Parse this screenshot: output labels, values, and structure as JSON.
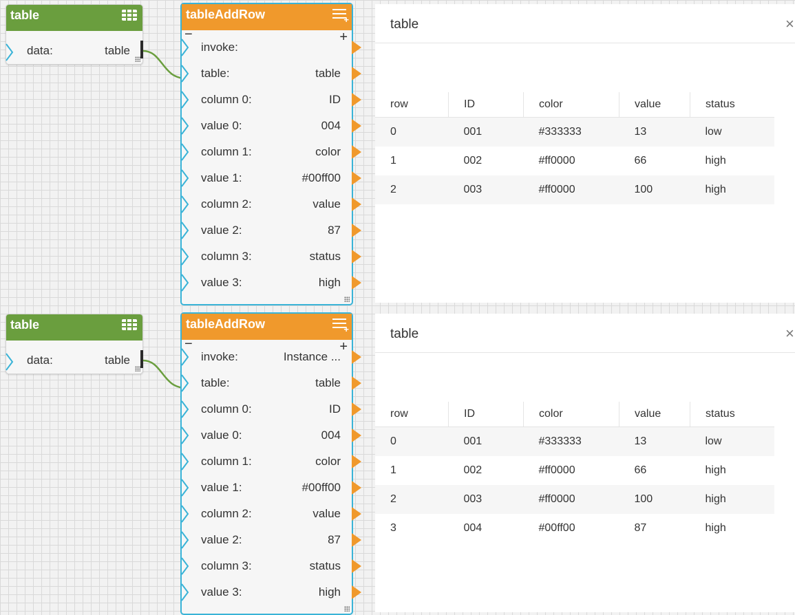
{
  "flows": [
    {
      "table_node": {
        "title": "table",
        "port_label": "data:",
        "port_value": "table"
      },
      "action_node": {
        "title": "tableAddRow",
        "rows": [
          {
            "label": "invoke:",
            "value": ""
          },
          {
            "label": "table:",
            "value": "table"
          },
          {
            "label": "column 0:",
            "value": "ID"
          },
          {
            "label": "value 0:",
            "value": "004"
          },
          {
            "label": "column 1:",
            "value": "color"
          },
          {
            "label": "value 1:",
            "value": "#00ff00"
          },
          {
            "label": "column 2:",
            "value": "value"
          },
          {
            "label": "value 2:",
            "value": "87"
          },
          {
            "label": "column 3:",
            "value": "status"
          },
          {
            "label": "value 3:",
            "value": "high"
          }
        ]
      },
      "panel": {
        "title": "table",
        "close": "×",
        "columns": [
          "row",
          "ID",
          "color",
          "value",
          "status"
        ],
        "rows": [
          [
            "0",
            "001",
            "#333333",
            "13",
            "low"
          ],
          [
            "1",
            "002",
            "#ff0000",
            "66",
            "high"
          ],
          [
            "2",
            "003",
            "#ff0000",
            "100",
            "high"
          ]
        ]
      }
    },
    {
      "table_node": {
        "title": "table",
        "port_label": "data:",
        "port_value": "table"
      },
      "action_node": {
        "title": "tableAddRow",
        "rows": [
          {
            "label": "invoke:",
            "value": "Instance ..."
          },
          {
            "label": "table:",
            "value": "table"
          },
          {
            "label": "column 0:",
            "value": "ID"
          },
          {
            "label": "value 0:",
            "value": "004"
          },
          {
            "label": "column 1:",
            "value": "color"
          },
          {
            "label": "value 1:",
            "value": "#00ff00"
          },
          {
            "label": "column 2:",
            "value": "value"
          },
          {
            "label": "value 2:",
            "value": "87"
          },
          {
            "label": "column 3:",
            "value": "status"
          },
          {
            "label": "value 3:",
            "value": "high"
          }
        ]
      },
      "panel": {
        "title": "table",
        "close": "×",
        "columns": [
          "row",
          "ID",
          "color",
          "value",
          "status"
        ],
        "rows": [
          [
            "0",
            "001",
            "#333333",
            "13",
            "low"
          ],
          [
            "1",
            "002",
            "#ff0000",
            "66",
            "high"
          ],
          [
            "2",
            "003",
            "#ff0000",
            "100",
            "high"
          ],
          [
            "3",
            "004",
            "#00ff00",
            "87",
            "high"
          ]
        ]
      }
    }
  ],
  "colors": {
    "table_node_header": "#6a9e3e",
    "action_node_header": "#f0992c",
    "selection_border": "#39b3d7",
    "connection": "#6a9e3e"
  }
}
